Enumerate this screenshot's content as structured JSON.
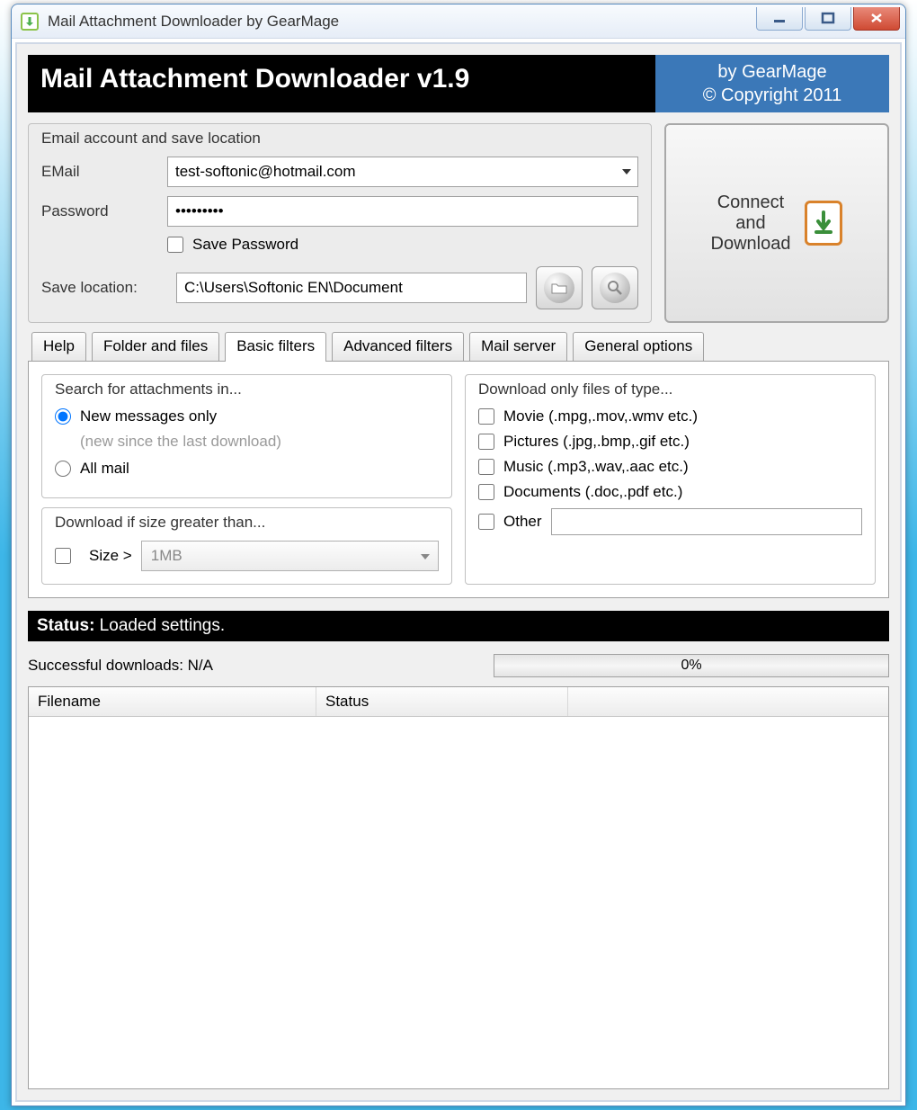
{
  "window": {
    "title": "Mail Attachment Downloader by GearMage"
  },
  "header": {
    "product_title": "Mail Attachment Downloader v1.9",
    "by_line": "by GearMage",
    "copyright": "© Copyright 2011"
  },
  "account_group": {
    "legend": "Email account and save location",
    "email_label": "EMail",
    "email_value": "test-softonic@hotmail.com",
    "password_label": "Password",
    "password_value": "•••••••••",
    "save_password_label": "Save Password",
    "save_location_label": "Save location:",
    "save_location_value": "C:\\Users\\Softonic EN\\Document"
  },
  "connect_button": {
    "label": "Connect\nand\nDownload"
  },
  "tabs": [
    "Help",
    "Folder and files",
    "Basic filters",
    "Advanced filters",
    "Mail server",
    "General options"
  ],
  "active_tab_index": 2,
  "basic_filters": {
    "search_legend": "Search for attachments in...",
    "radio_new": "New messages only",
    "radio_new_hint": "(new since the last download)",
    "radio_all": "All mail",
    "size_legend": "Download if size greater than...",
    "size_label": "Size >",
    "size_value": "1MB",
    "types_legend": "Download only files of type...",
    "type_movie": "Movie (.mpg,.mov,.wmv etc.)",
    "type_pictures": "Pictures (.jpg,.bmp,.gif etc.)",
    "type_music": "Music (.mp3,.wav,.aac etc.)",
    "type_documents": "Documents (.doc,.pdf etc.)",
    "type_other": "Other",
    "other_value": ""
  },
  "status": {
    "label": "Status:",
    "text": " Loaded settings."
  },
  "downloads": {
    "label": "Successful downloads: N/A",
    "progress_text": "0%"
  },
  "grid": {
    "columns": [
      "Filename",
      "Status",
      ""
    ]
  }
}
